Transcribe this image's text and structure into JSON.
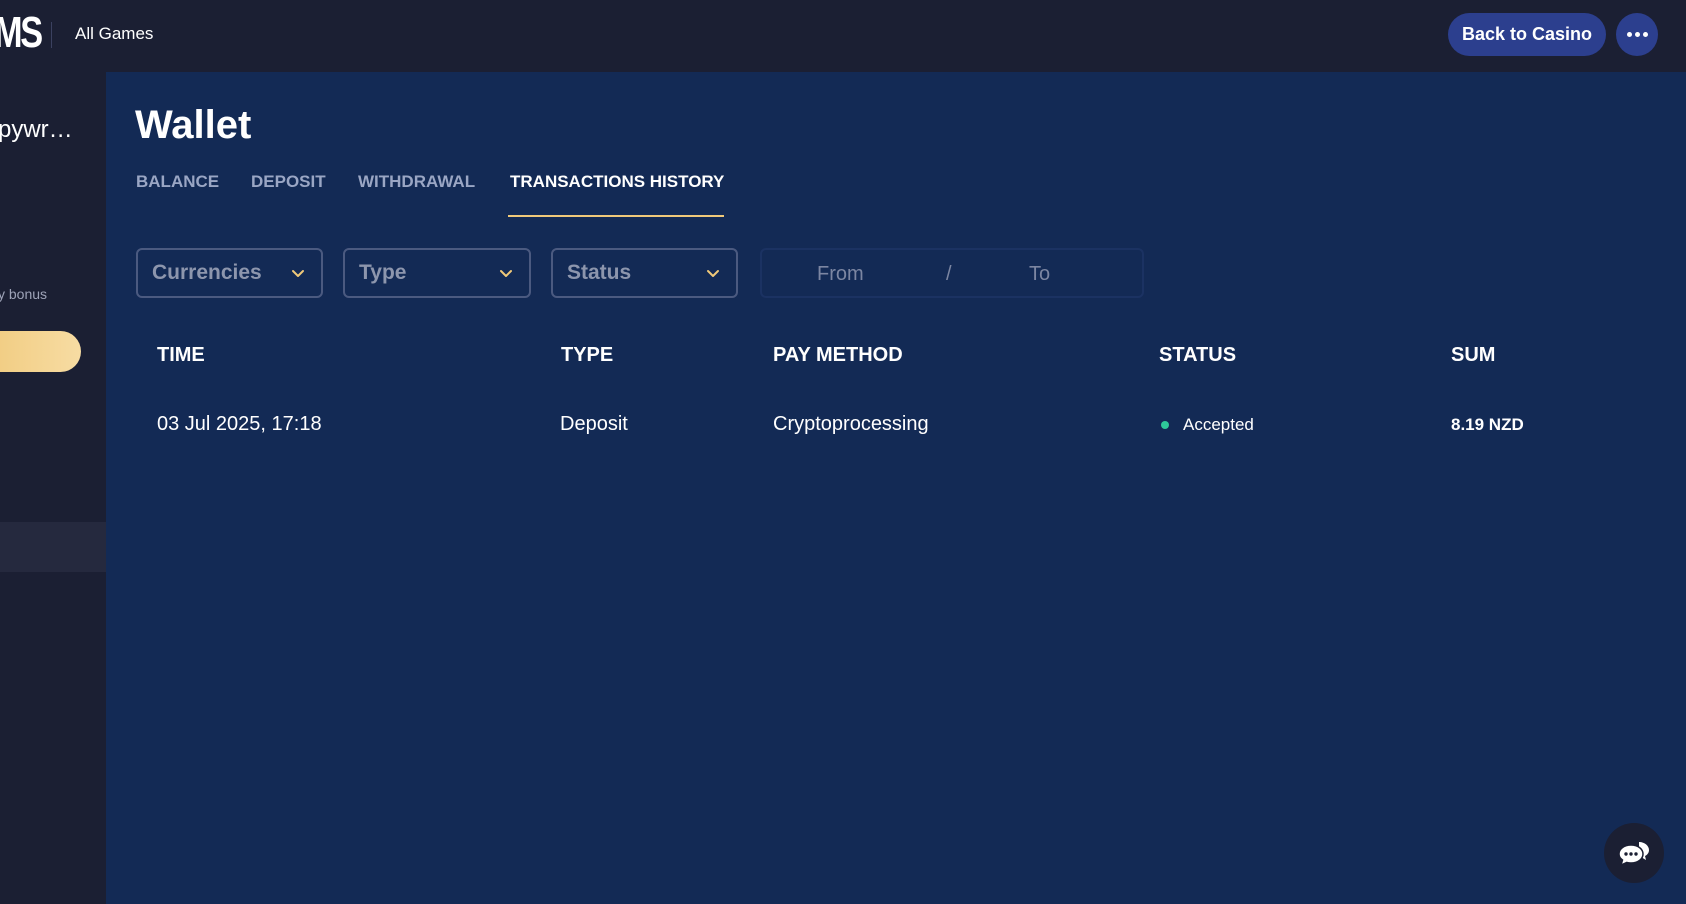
{
  "header": {
    "logo_text": "MS",
    "all_games_label": "All Games",
    "back_to_casino_label": "Back to Casino",
    "more_icon": "more-dots-icon"
  },
  "sidebar": {
    "username": "pywr…",
    "bonus_text": "y bonus"
  },
  "page": {
    "title": "Wallet",
    "tabs": [
      {
        "label": "BALANCE",
        "active": false
      },
      {
        "label": "DEPOSIT",
        "active": false
      },
      {
        "label": "WITHDRAWAL",
        "active": false
      },
      {
        "label": "TRANSACTIONS HISTORY",
        "active": true
      }
    ]
  },
  "filters": {
    "currencies": "Currencies",
    "type": "Type",
    "status": "Status",
    "date_from_placeholder": "From",
    "date_separator": "/",
    "date_to_placeholder": "To"
  },
  "table": {
    "headers": [
      "TIME",
      "TYPE",
      "PAY METHOD",
      "STATUS",
      "SUM"
    ],
    "rows": [
      {
        "time": "03 Jul 2025, 17:18",
        "type": "Deposit",
        "pay_method": "Cryptoprocessing",
        "status": "Accepted",
        "sum": "8.19 NZD"
      }
    ]
  },
  "colors": {
    "background": "#132a55",
    "topbar": "#1b1f33",
    "accent_gold": "#f0c97a",
    "button_blue": "#2c3f8e",
    "status_accepted": "#2ec99a"
  },
  "chat_icon": "chat-bubble-icon"
}
